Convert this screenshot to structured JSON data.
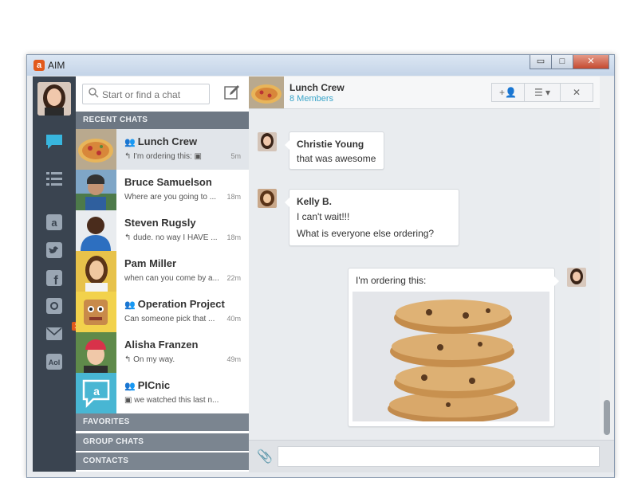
{
  "window": {
    "title": "AIM",
    "logo_glyph": "a",
    "controls": {
      "minimize": "▭",
      "maximize": "□",
      "close": "✕"
    }
  },
  "rail": {
    "items": [
      {
        "icon": "chat-bubble-icon",
        "glyph": "💬",
        "active": true
      },
      {
        "icon": "list-icon",
        "glyph": "☷",
        "active": false
      },
      {
        "icon": "aim-icon",
        "glyph": "@",
        "active": false
      },
      {
        "icon": "twitter-icon",
        "glyph": "🐦",
        "active": false
      },
      {
        "icon": "facebook-icon",
        "glyph": "f",
        "active": false
      },
      {
        "icon": "instagram-icon",
        "glyph": "◙",
        "active": false
      },
      {
        "icon": "mail-icon",
        "glyph": "✉",
        "active": false,
        "badge": "1"
      },
      {
        "icon": "aol-icon",
        "glyph": "Aol",
        "active": false
      }
    ]
  },
  "search": {
    "placeholder": "Start or find a chat"
  },
  "compose_glyph": "✎",
  "sections": {
    "recent": "RECENT CHATS",
    "favorites": "FAVORITES",
    "group": "GROUP CHATS",
    "contacts": "CONTACTS"
  },
  "chats": [
    {
      "name": "Lunch Crew",
      "group": true,
      "preview": "↰ I'm ordering this: ▣",
      "time": "5m",
      "selected": true,
      "thumb": "pizza"
    },
    {
      "name": "Bruce Samuelson",
      "group": false,
      "preview": "Where are you going to ...",
      "time": "18m",
      "selected": false,
      "thumb": "man-cap"
    },
    {
      "name": "Steven Rugsly",
      "group": false,
      "preview": "↰ dude. no way I HAVE ...",
      "time": "18m",
      "selected": false,
      "thumb": "man-blue"
    },
    {
      "name": "Pam Miller",
      "group": false,
      "preview": "when can you come by a...",
      "time": "22m",
      "selected": false,
      "thumb": "woman-sun"
    },
    {
      "name": "Operation Project",
      "group": true,
      "preview": "Can someone pick that ...",
      "time": "40m",
      "selected": false,
      "thumb": "cartoon"
    },
    {
      "name": "Alisha Franzen",
      "group": false,
      "preview": "↰ On my way.",
      "time": "49m",
      "selected": false,
      "thumb": "woman-hat"
    },
    {
      "name": "PICnic",
      "group": true,
      "preview": "▣ we watched this last n...",
      "time": "",
      "selected": false,
      "thumb": "aim-logo"
    }
  ],
  "conversation": {
    "title": "Lunch Crew",
    "members": "8 Members",
    "header_buttons": {
      "add_user": "+👤",
      "menu": "☰ ▾",
      "close": "✕"
    },
    "messages": [
      {
        "sender": "Christie Young",
        "lines": [
          "that was awesome"
        ]
      },
      {
        "sender": "Kelly B.",
        "lines": [
          "I can't wait!!!",
          "What is everyone else ordering?"
        ]
      }
    ],
    "own_message": {
      "text": "I'm ordering this:",
      "attachment": "cookies-photo"
    }
  },
  "composer": {
    "value": "",
    "placeholder": "",
    "attach_glyph": "📎"
  }
}
